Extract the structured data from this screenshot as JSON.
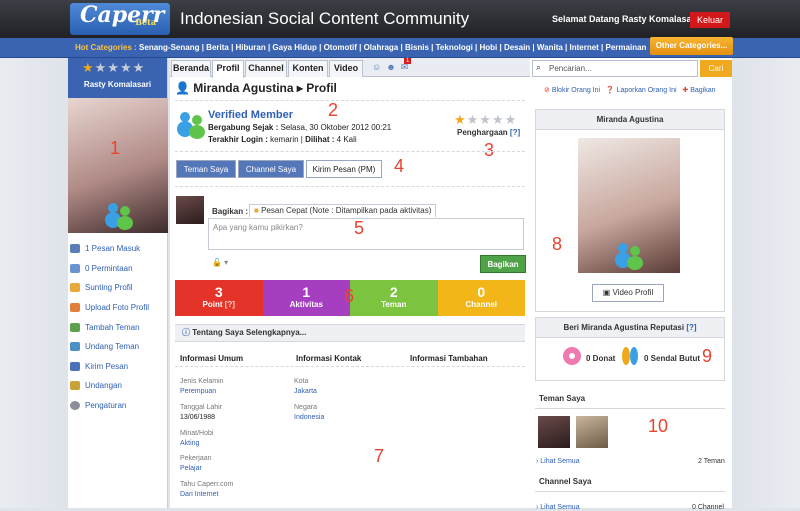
{
  "header": {
    "logo": "Caperr",
    "logo_tag": "Beta",
    "slogan": "Indonesian Social Content Community",
    "welcome": "Selamat Datang Rasty Komalasari,",
    "logout": "Keluar"
  },
  "categories": {
    "label": "Hot Categories :",
    "items": "Senang-Senang | Berita | Hiburan | Gaya Hidup | Otomotif | Olahraga | Bisnis | Teknologi | Hobi | Desain | Wanita | Internet | Permainan",
    "other": "Other Categories..."
  },
  "user": {
    "name": "Rasty Komalasari",
    "menu": [
      "1 Pesan Masuk",
      "0 Permintaan",
      "Sunting Profil",
      "Upload Foto Profil",
      "Tambah Teman",
      "Undang Teman",
      "Kirim Pesan",
      "Undangan",
      "Pengaturan"
    ]
  },
  "tabs": [
    "Beranda",
    "Profil",
    "Channel",
    "Konten",
    "Video"
  ],
  "notif_count": "1",
  "profile": {
    "title": "Miranda Agustina ▸ Profil",
    "verified": "Verified Member",
    "joined_label": "Bergabung Sejak :",
    "joined": "Selasa, 30 Oktober 2012 00:21",
    "login_label": "Terakhir Login :",
    "login": "kemarin",
    "seen_label": "Dilihat :",
    "seen": "4 Kali",
    "award": "Penghargaan",
    "award_help": "[?]"
  },
  "buttons": {
    "friends": "Teman Saya",
    "channel": "Channel Saya",
    "message": "Kirim Pesan (PM)"
  },
  "share": {
    "label": "Bagikan :",
    "tab": "Pesan Cepat (Note : Ditampilkan pada aktivitas)",
    "placeholder": "Apa yang kamu pikirkan?",
    "button": "Bagikan"
  },
  "stats": [
    {
      "value": "3",
      "label": "Point",
      "extra": "[?]",
      "color": "#e4342a"
    },
    {
      "value": "1",
      "label": "Aktivitas",
      "color": "#a53fc0"
    },
    {
      "value": "2",
      "label": "Teman",
      "color": "#7cc440"
    },
    {
      "value": "0",
      "label": "Channel",
      "color": "#f2b619"
    }
  ],
  "about": {
    "title": "Tentang Saya Selengkapnya...",
    "col1": "Informasi Umum",
    "col2": "Informasi Kontak",
    "col3": "Informasi Tambahan",
    "gender_l": "Jenis Kelamin",
    "gender": "Perempuan",
    "dob_l": "Tanggal Lahir",
    "dob": "13/06/1988",
    "hobby_l": "Minat/Hobi",
    "hobby": "Akting",
    "job_l": "Pekerjaan",
    "job": "Pelajar",
    "know_l": "Tahu Caperr.com",
    "know": "Dari Internet",
    "city_l": "Kota",
    "city": "Jakarta",
    "country_l": "Negara",
    "country": "Indonesia"
  },
  "right": {
    "search_placeholder": "Pencarian...",
    "search_btn": "Cari",
    "block": "Blokir Orang Ini",
    "report": "Laporkan Orang Ini",
    "share": "Bagikan",
    "name": "Miranda Agustina",
    "video": "Video Profil",
    "rep_title": "Beri Miranda Agustina Reputasi",
    "rep_help": "[?]",
    "donat": "0 Donat",
    "sendal": "0 Sendal Butut",
    "friends_title": "Teman Saya",
    "see_all": "Lihat Semua",
    "friend_count": "2 Teman",
    "channel_title": "Channel Saya",
    "see_all2": "Lihat Semua",
    "channel_count": "0 Channel"
  },
  "annotations": [
    "1",
    "2",
    "3",
    "4",
    "5",
    "6",
    "7",
    "8",
    "9",
    "10"
  ],
  "colors": {
    "brand": "#3a64b1",
    "accent": "#f0a91d",
    "logout": "#d2181a",
    "share": "#4fa247",
    "annotation": "#e8432f"
  }
}
